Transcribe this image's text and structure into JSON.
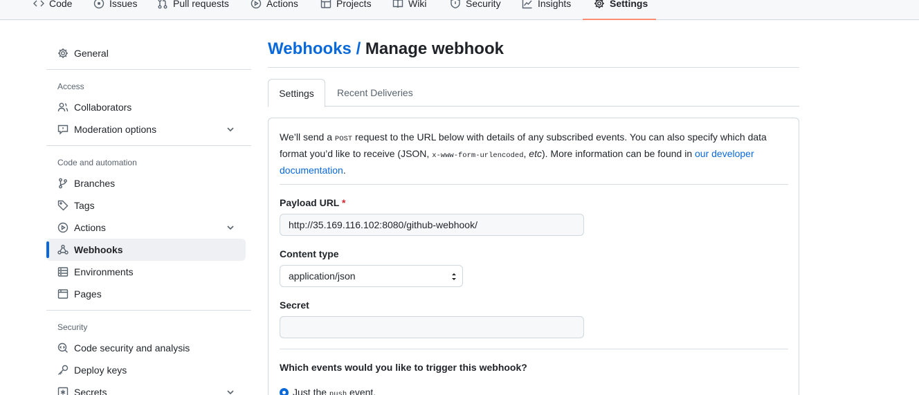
{
  "repo_nav": {
    "tabs": [
      {
        "label": "Code",
        "icon": "code-icon"
      },
      {
        "label": "Issues",
        "icon": "issue-icon"
      },
      {
        "label": "Pull requests",
        "icon": "pull-request-icon"
      },
      {
        "label": "Actions",
        "icon": "play-icon"
      },
      {
        "label": "Projects",
        "icon": "table-icon"
      },
      {
        "label": "Wiki",
        "icon": "book-icon"
      },
      {
        "label": "Security",
        "icon": "shield-icon"
      },
      {
        "label": "Insights",
        "icon": "graph-icon"
      },
      {
        "label": "Settings",
        "icon": "gear-icon",
        "selected": true
      }
    ]
  },
  "sidebar": {
    "general": "General",
    "access_heading": "Access",
    "collaborators": "Collaborators",
    "moderation": "Moderation options",
    "code_heading": "Code and automation",
    "branches": "Branches",
    "tags": "Tags",
    "actions": "Actions",
    "webhooks": "Webhooks",
    "environments": "Environments",
    "pages": "Pages",
    "security_heading": "Security",
    "code_security": "Code security and analysis",
    "deploy_keys": "Deploy keys",
    "secrets": "Secrets"
  },
  "main": {
    "breadcrumb": "Webhooks",
    "separator": "/",
    "title": "Manage webhook",
    "tabs": [
      "Settings",
      "Recent Deliveries"
    ],
    "intro": {
      "part1": "We’ll send a ",
      "code1": "POST",
      "part2": " request to the URL below with details of any subscribed events. You can also specify which data format you’d like to receive (JSON, ",
      "code2": "x-www-form-urlencoded",
      "part3": ", ",
      "etc": "etc",
      "part4": "). More information can be found in ",
      "link": "our developer documentation",
      "part5": "."
    },
    "payload_url_label": "Payload URL",
    "required_mark": "*",
    "payload_url_value": "http://35.169.116.102:8080/github-webhook/",
    "content_type_label": "Content type",
    "content_type_value": "application/json",
    "secret_label": "Secret",
    "secret_value": "",
    "events_question": "Which events would you like to trigger this webhook?",
    "radio_just": "Just the ",
    "radio_code": "push",
    "radio_event": " event."
  },
  "colors": {
    "accent": "#0969da",
    "nav_underline": "#fd8c73",
    "required": "#d1242f"
  }
}
